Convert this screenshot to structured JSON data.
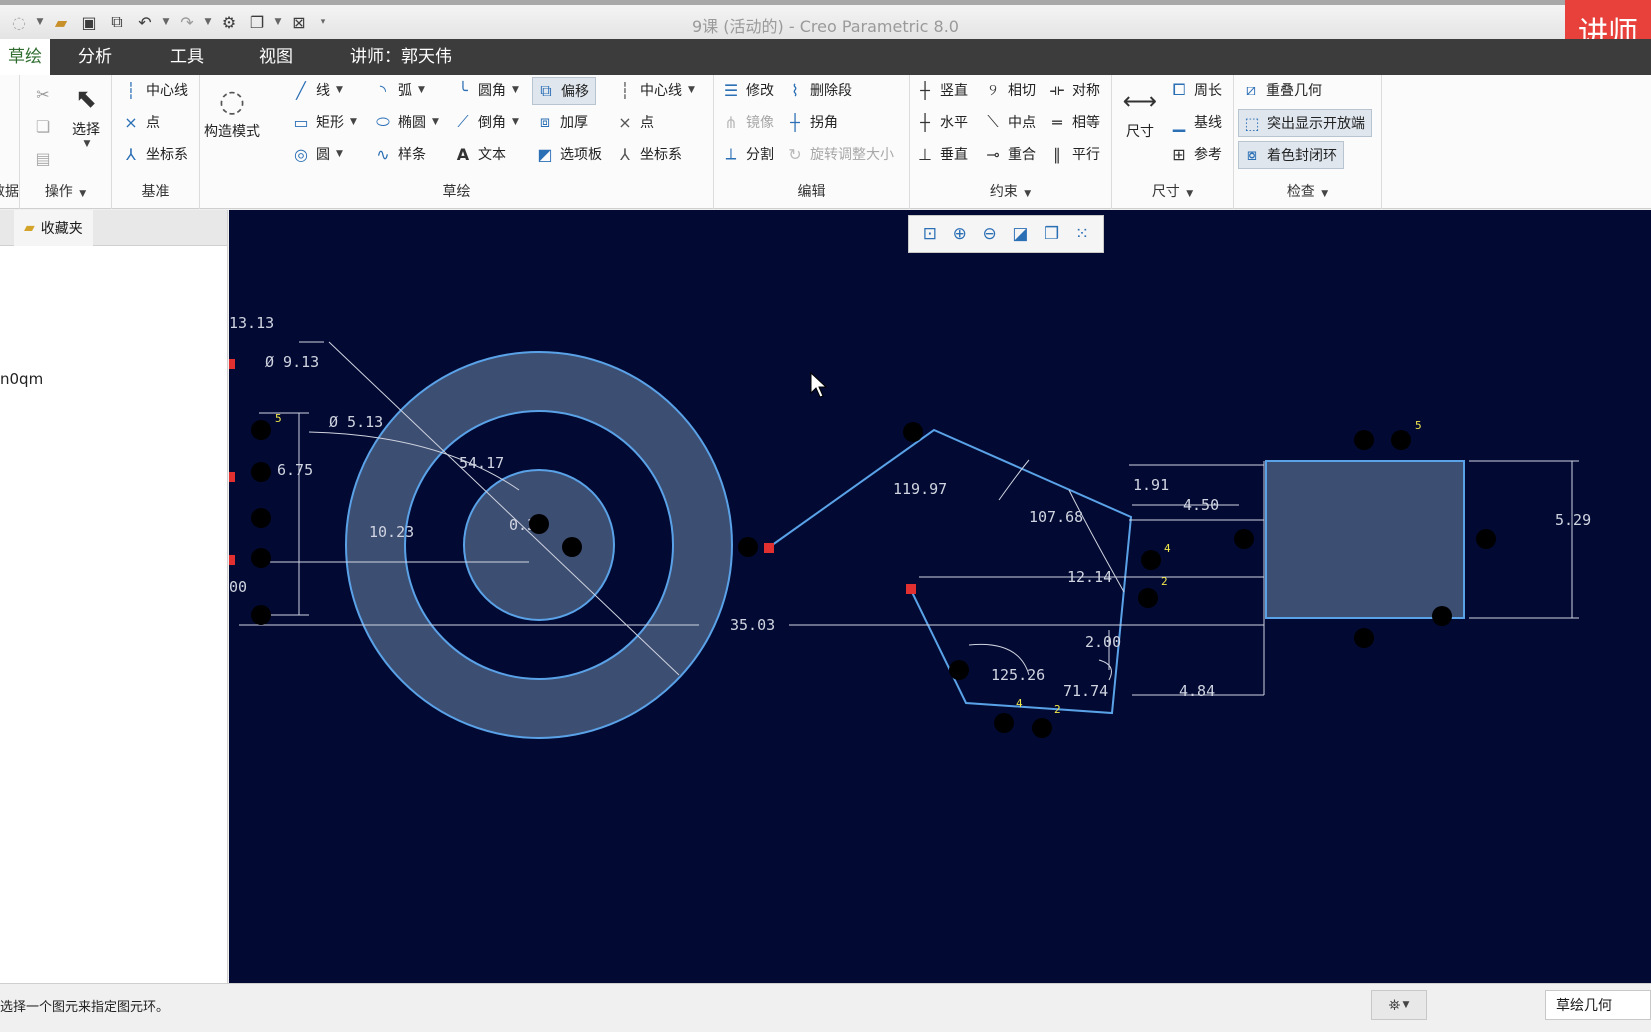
{
  "window": {
    "title": "9课 (活动的) - Creo Parametric 8.0",
    "badge": "讲师"
  },
  "tabs": [
    {
      "label": "草绘"
    },
    {
      "label": "分析"
    },
    {
      "label": "工具"
    },
    {
      "label": "视图"
    },
    {
      "label": "讲师：郭天伟"
    }
  ],
  "ribbon": {
    "data_group": {
      "label": "数据"
    },
    "operations": {
      "label": "操作",
      "select": "选择"
    },
    "datum": {
      "label": "基准",
      "centerline": "中心线",
      "point": "点",
      "csys": "坐标系"
    },
    "construction": {
      "label": "构造模式"
    },
    "sketch": {
      "label": "草绘",
      "line": "线",
      "rectangle": "矩形",
      "circle": "圆",
      "arc": "弧",
      "ellipse": "椭圆",
      "spline": "样条",
      "fillet": "圆角",
      "chamfer": "倒角",
      "text": "文本",
      "offset": "偏移",
      "thicken": "加厚",
      "palette": "选项板",
      "centerline": "中心线",
      "point": "点",
      "csys": "坐标系"
    },
    "edit": {
      "label": "编辑",
      "modify": "修改",
      "mirror": "镜像",
      "divide": "分割",
      "delete_segment": "删除段",
      "corner": "拐角",
      "rotate_resize": "旋转调整大小"
    },
    "constrain": {
      "label": "约束",
      "vertical": "竖直",
      "horizontal": "水平",
      "perpendicular": "垂直",
      "tangent": "相切",
      "midpoint": "中点",
      "coincident": "重合",
      "symmetric": "对称",
      "equal": "相等",
      "parallel": "平行"
    },
    "dimension": {
      "label": "尺寸",
      "dimension": "尺寸",
      "perimeter": "周长",
      "baseline": "基线",
      "reference": "参考"
    },
    "inspect": {
      "label": "检查",
      "overlapping": "重叠几何",
      "highlight_open": "突出显示开放端",
      "shade_closed": "着色封闭环"
    }
  },
  "leftpanel": {
    "tab_label": "收藏夹",
    "item": "n0qm"
  },
  "canvas": {
    "dimensions": [
      "13.13",
      "Ø 9.13",
      "Ø 5.13",
      "6.75",
      "10.23",
      "0.39",
      "54.17",
      "35.03",
      "119.97",
      "107.68",
      "1.91",
      "4.50",
      "12.14",
      "5.29",
      "2.00",
      "125.26",
      "71.74",
      "4.84",
      "00"
    ],
    "constraint_labels": [
      "5",
      "4",
      "2",
      "4",
      "2",
      "5"
    ]
  },
  "statusbar": {
    "message": "选择一个图元来指定图元环。",
    "filter": "草绘几何"
  }
}
